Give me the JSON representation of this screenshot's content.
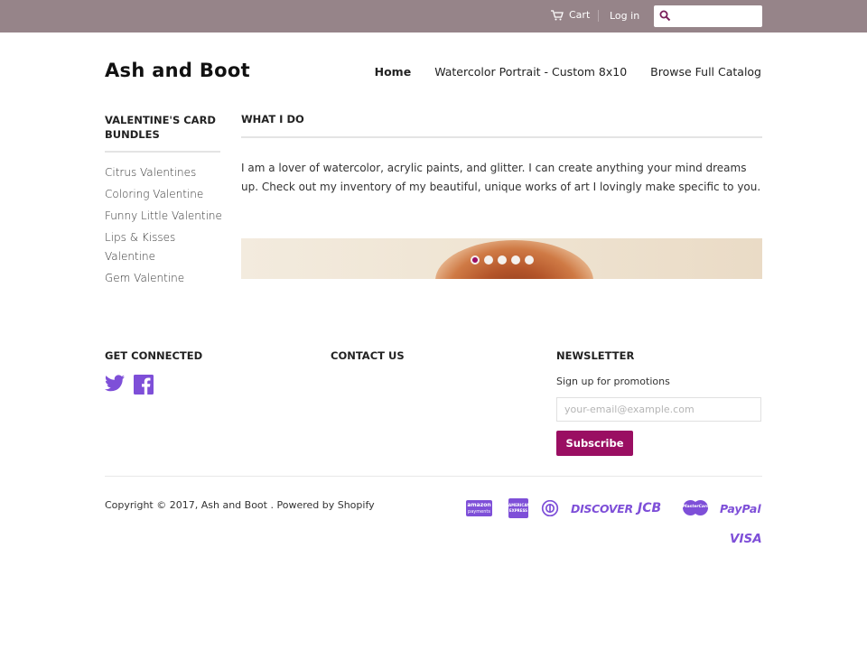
{
  "topbar": {
    "cart_label": "Cart",
    "login_label": "Log in",
    "search_placeholder": "",
    "icons": [
      "cart-icon",
      "search-icon"
    ]
  },
  "header": {
    "logo": "Ash and Boot",
    "nav": [
      {
        "label": "Home",
        "active": true
      },
      {
        "label": "Watercolor Portrait - Custom 8x10",
        "active": false
      },
      {
        "label": "Browse Full Catalog",
        "active": false
      }
    ]
  },
  "sidebar": {
    "title": "Valentine's Card Bundles",
    "items": [
      {
        "label": "Citrus Valentines"
      },
      {
        "label": "Coloring Valentine"
      },
      {
        "label": "Funny Little Valentine"
      },
      {
        "label": "Lips & Kisses Valentine"
      },
      {
        "label": "Gem Valentine"
      }
    ]
  },
  "main": {
    "title": "What I Do",
    "text": "I am a lover of watercolor, acrylic paints, and glitter. I can create anything your mind dreams up. Check out my inventory of my beautiful, unique works of art I lovingly make specific to you.",
    "slideshow": {
      "slide_count": 5,
      "active_index": 0
    }
  },
  "footer": {
    "connected_title": "Get Connected",
    "social_icons": [
      "twitter-icon",
      "facebook-icon"
    ],
    "contact_title": "Contact Us",
    "newsletter_title": "Newsletter",
    "newsletter_text": "Sign up for promotions",
    "email_placeholder": "your-email@example.com",
    "subscribe_label": "Subscribe",
    "copyright_prefix": "Copyright © 2017,",
    "shop_name": "Ash and Boot",
    "powered_by": ". Powered by Shopify",
    "payment_icons": [
      "amazon-payments-icon",
      "american-express-icon",
      "diners-club-icon",
      "discover-icon",
      "jcb-icon",
      "mastercard-icon",
      "paypal-icon",
      "visa-icon"
    ],
    "payment_labels": {
      "amazon_top": "amazon",
      "amazon_bottom": "payments",
      "amex_top": "AMERICAN",
      "amex_bottom": "EXPRESS",
      "discover": "DISCOVER",
      "jcb": "JCB",
      "mastercard": "MasterCard",
      "paypal": "PayPal",
      "visa": "VISA"
    }
  },
  "colors": {
    "topbar": "#968489",
    "accent": "#9a0e62",
    "icon": "#7e4fd8"
  }
}
